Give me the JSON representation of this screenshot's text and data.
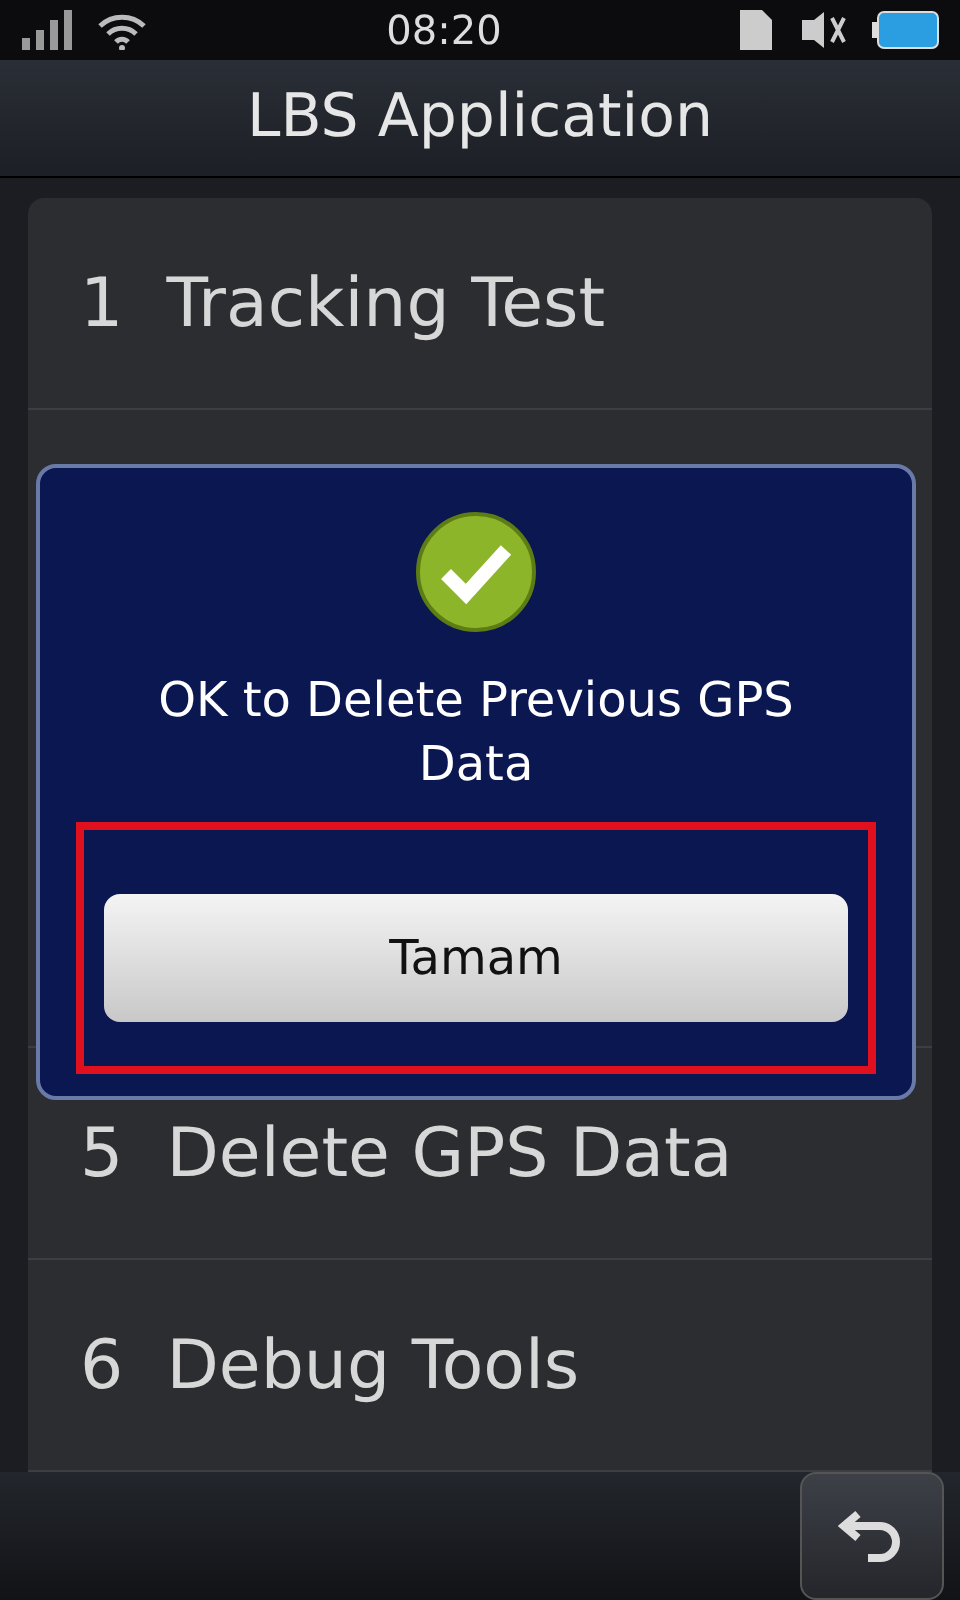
{
  "status_bar": {
    "time": "08:20"
  },
  "header": {
    "title": "LBS Application"
  },
  "menu": [
    {
      "number": "1",
      "label": "Tracking Test"
    },
    {
      "number": "5",
      "label": "Delete GPS Data"
    },
    {
      "number": "6",
      "label": "Debug Tools"
    }
  ],
  "dialog": {
    "message": "OK to Delete Previous GPS Data",
    "button": "Tamam",
    "highlighted": true
  }
}
